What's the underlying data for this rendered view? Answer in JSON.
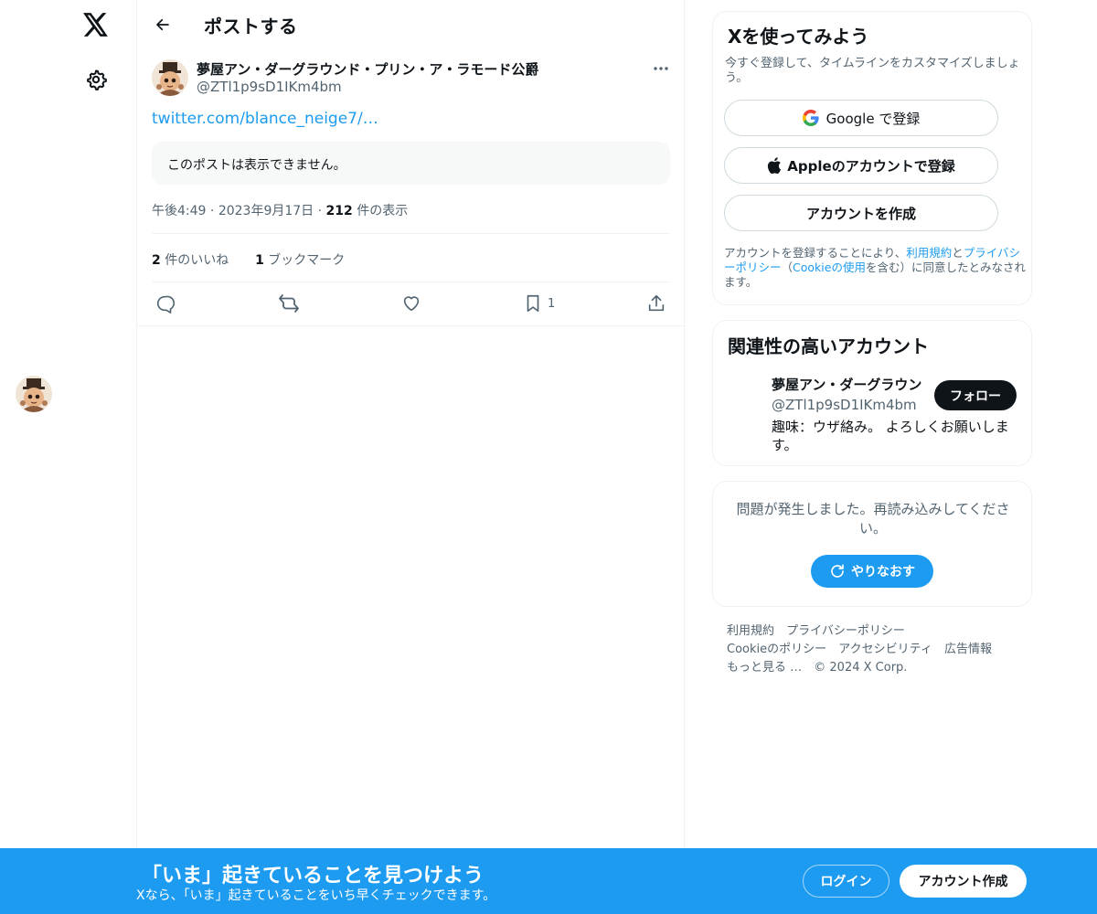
{
  "nav": {
    "logo_icon": "x-logo-icon",
    "settings_icon": "gear-icon"
  },
  "header": {
    "back_icon": "arrow-left-icon",
    "title": "ポストする"
  },
  "post": {
    "author_name": "夢屋アン・ダーグラウンド・プリン・ア・ラモード公爵",
    "author_handle": "@ZTl1p9sD1IKm4bm",
    "link_text": "twitter.com/blance_neige7/…",
    "unavailable_text": "このポストは表示できません。",
    "time": "午後4:49",
    "date": "2023年9月17日",
    "views_count": "212",
    "views_label": " 件の表示",
    "likes_count": "2",
    "likes_label": " 件のいいね",
    "bookmarks_count": "1",
    "bookmarks_label": " ブックマーク",
    "actions": {
      "reply_icon": "reply-icon",
      "repost_icon": "repost-icon",
      "like_icon": "heart-icon",
      "bookmark_icon": "bookmark-icon",
      "bookmark_count": "1",
      "share_icon": "share-icon"
    }
  },
  "signup": {
    "title": "Xを使ってみよう",
    "subtitle": "今すぐ登録して、タイムラインをカスタマイズしましょう。",
    "google_label": "Google で登録",
    "apple_label": "Appleのアカウントで登録",
    "create_label": "アカウントを作成",
    "terms_pre": "アカウントを登録することにより、",
    "terms_link": "利用規約",
    "terms_and": "と",
    "privacy_link": "プライバシーポリシー",
    "terms_mid": "（",
    "cookie_link": "Cookieの使用",
    "terms_post": "を含む）に同意したとみなされます。"
  },
  "related": {
    "title": "関連性の高いアカウント",
    "name": "夢屋アン・ダーグラウン",
    "handle": "@ZTl1p9sD1IKm4bm",
    "follow_label": "フォロー",
    "bio": "趣味：ウザ絡み。 よろしくお願いします。"
  },
  "error": {
    "message": "問題が発生しました。再読み込みしてください。",
    "retry_label": "やりなおす"
  },
  "footer": {
    "links": [
      "利用規約",
      "プライバシーポリシー",
      "Cookieのポリシー",
      "アクセシビリティ",
      "広告情報",
      "もっと見る …"
    ],
    "copyright": "© 2024 X Corp."
  },
  "bottom_bar": {
    "title": "「いま」起きていることを見つけよう",
    "subtitle": "Xなら、「いま」起きていることをいち早くチェックできます。",
    "login_label": "ログイン",
    "create_label": "アカウント作成"
  },
  "colors": {
    "accent": "#1d9bf0",
    "text": "#0f1419",
    "muted": "#536471",
    "border": "#eff3f4"
  }
}
